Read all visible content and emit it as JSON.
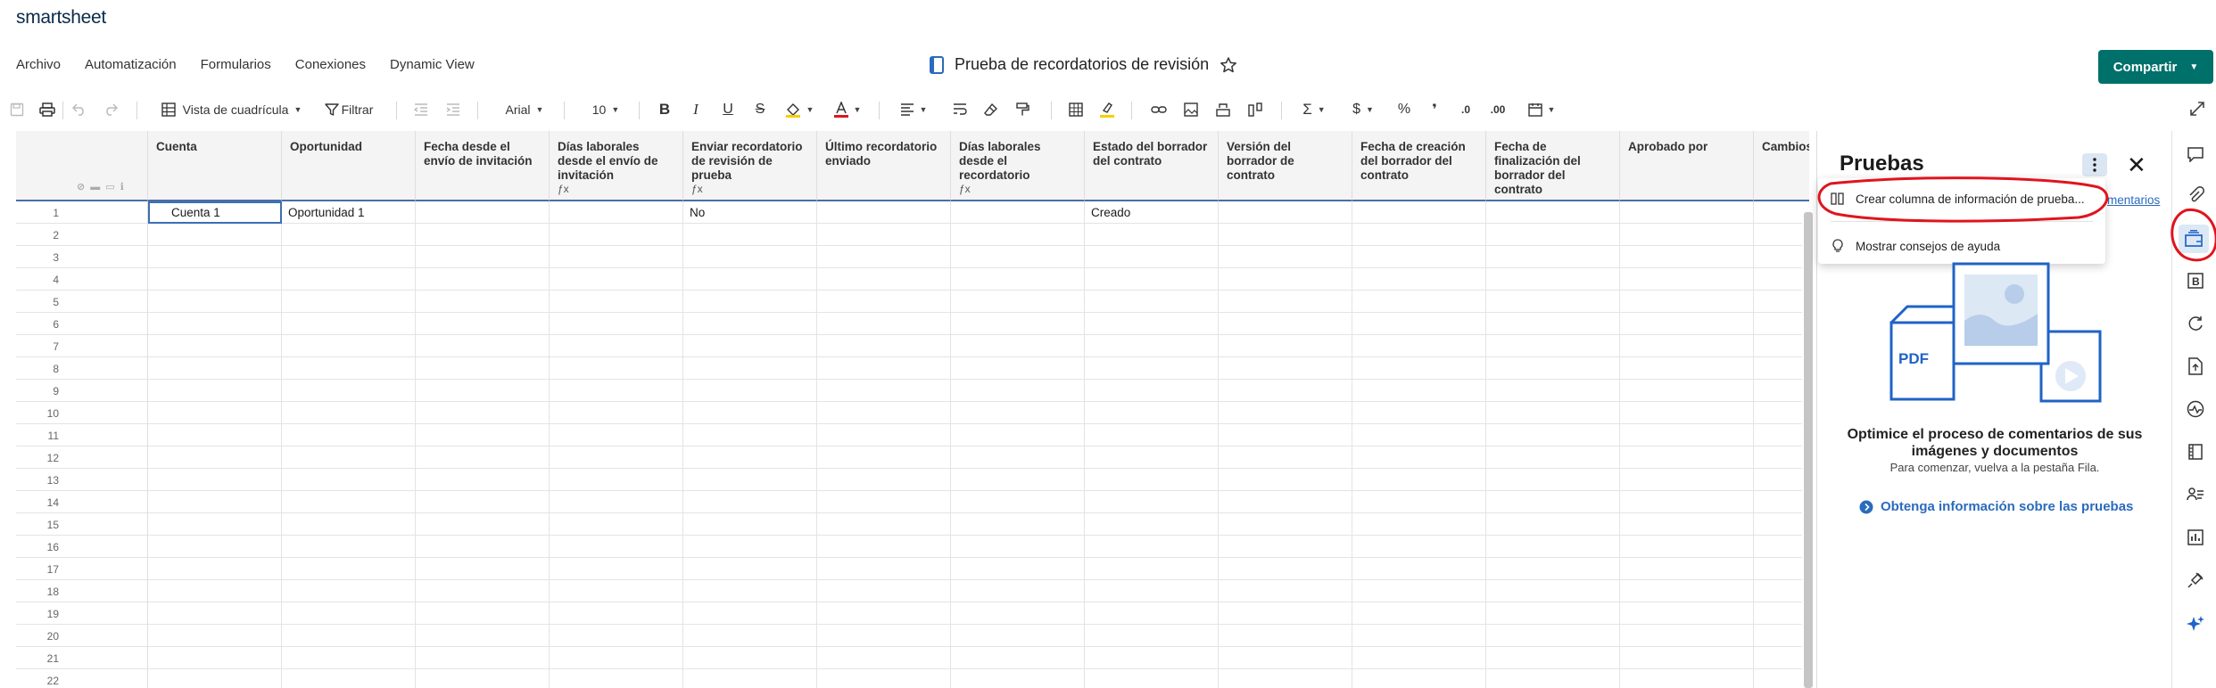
{
  "app": {
    "brand": "smartsheet"
  },
  "menu": [
    "Archivo",
    "Automatización",
    "Formularios",
    "Conexiones",
    "Dynamic View"
  ],
  "document": {
    "title": "Prueba de recordatorios de revisión"
  },
  "share_label": "Compartir",
  "toolbar": {
    "view_label": "Vista de cuadrícula",
    "filter_label": "Filtrar",
    "font": "Arial",
    "font_size": "10"
  },
  "grid": {
    "columns": [
      {
        "label": "Cuenta",
        "formula": false
      },
      {
        "label": "Oportunidad",
        "formula": false
      },
      {
        "label": "Fecha desde el envío de invitación",
        "formula": false
      },
      {
        "label": "Días laborales desde el envío de invitación",
        "formula": true
      },
      {
        "label": "Enviar recordatorio de revisión de prueba",
        "formula": true
      },
      {
        "label": "Último recordatorio enviado",
        "formula": false
      },
      {
        "label": "Días laborales desde el recordatorio",
        "formula": true
      },
      {
        "label": "Estado del borrador del contrato",
        "formula": false
      },
      {
        "label": "Versión del borrador de contrato",
        "formula": false
      },
      {
        "label": "Fecha de creación del borrador del contrato",
        "formula": false
      },
      {
        "label": "Fecha de finalización del borrador del contrato",
        "formula": false
      },
      {
        "label": "Aprobado por",
        "formula": false
      },
      {
        "label": "Cambios r por",
        "formula": false
      }
    ],
    "row_numbers": [
      "1",
      "2",
      "3",
      "4",
      "5",
      "6",
      "7",
      "8",
      "9",
      "10",
      "11",
      "12",
      "13",
      "14",
      "15",
      "16",
      "17",
      "18",
      "19",
      "20",
      "21",
      "22"
    ],
    "rows": [
      [
        "Cuenta 1",
        "Oportunidad 1",
        "",
        "",
        "No",
        "",
        "",
        "Creado",
        "",
        "",
        "",
        "",
        ""
      ]
    ]
  },
  "panel": {
    "title": "Pruebas",
    "menu_items": [
      "Crear columna de información de prueba...",
      "Mostrar consejos de ayuda"
    ],
    "comments_link": "mentarios",
    "pdf_label": "PDF",
    "heading": "Optimice el proceso de comentarios de sus imágenes y documentos",
    "subtext": "Para comenzar, vuelva a la pestaña Fila.",
    "learn_link": "Obtenga información sobre las pruebas"
  },
  "colors": {
    "accent": "#00706a",
    "link": "#2a6bbd",
    "annotation": "#e0141e",
    "illustration": "#1f63c6"
  },
  "rail_icons": [
    "comment-icon",
    "attachment-icon",
    "proofing-icon",
    "update-requests-icon",
    "activity-icon",
    "publish-icon",
    "summary-icon",
    "forms-icon",
    "contacts-icon",
    "reports-icon",
    "integrations-icon",
    "ai-sparkle-icon"
  ]
}
